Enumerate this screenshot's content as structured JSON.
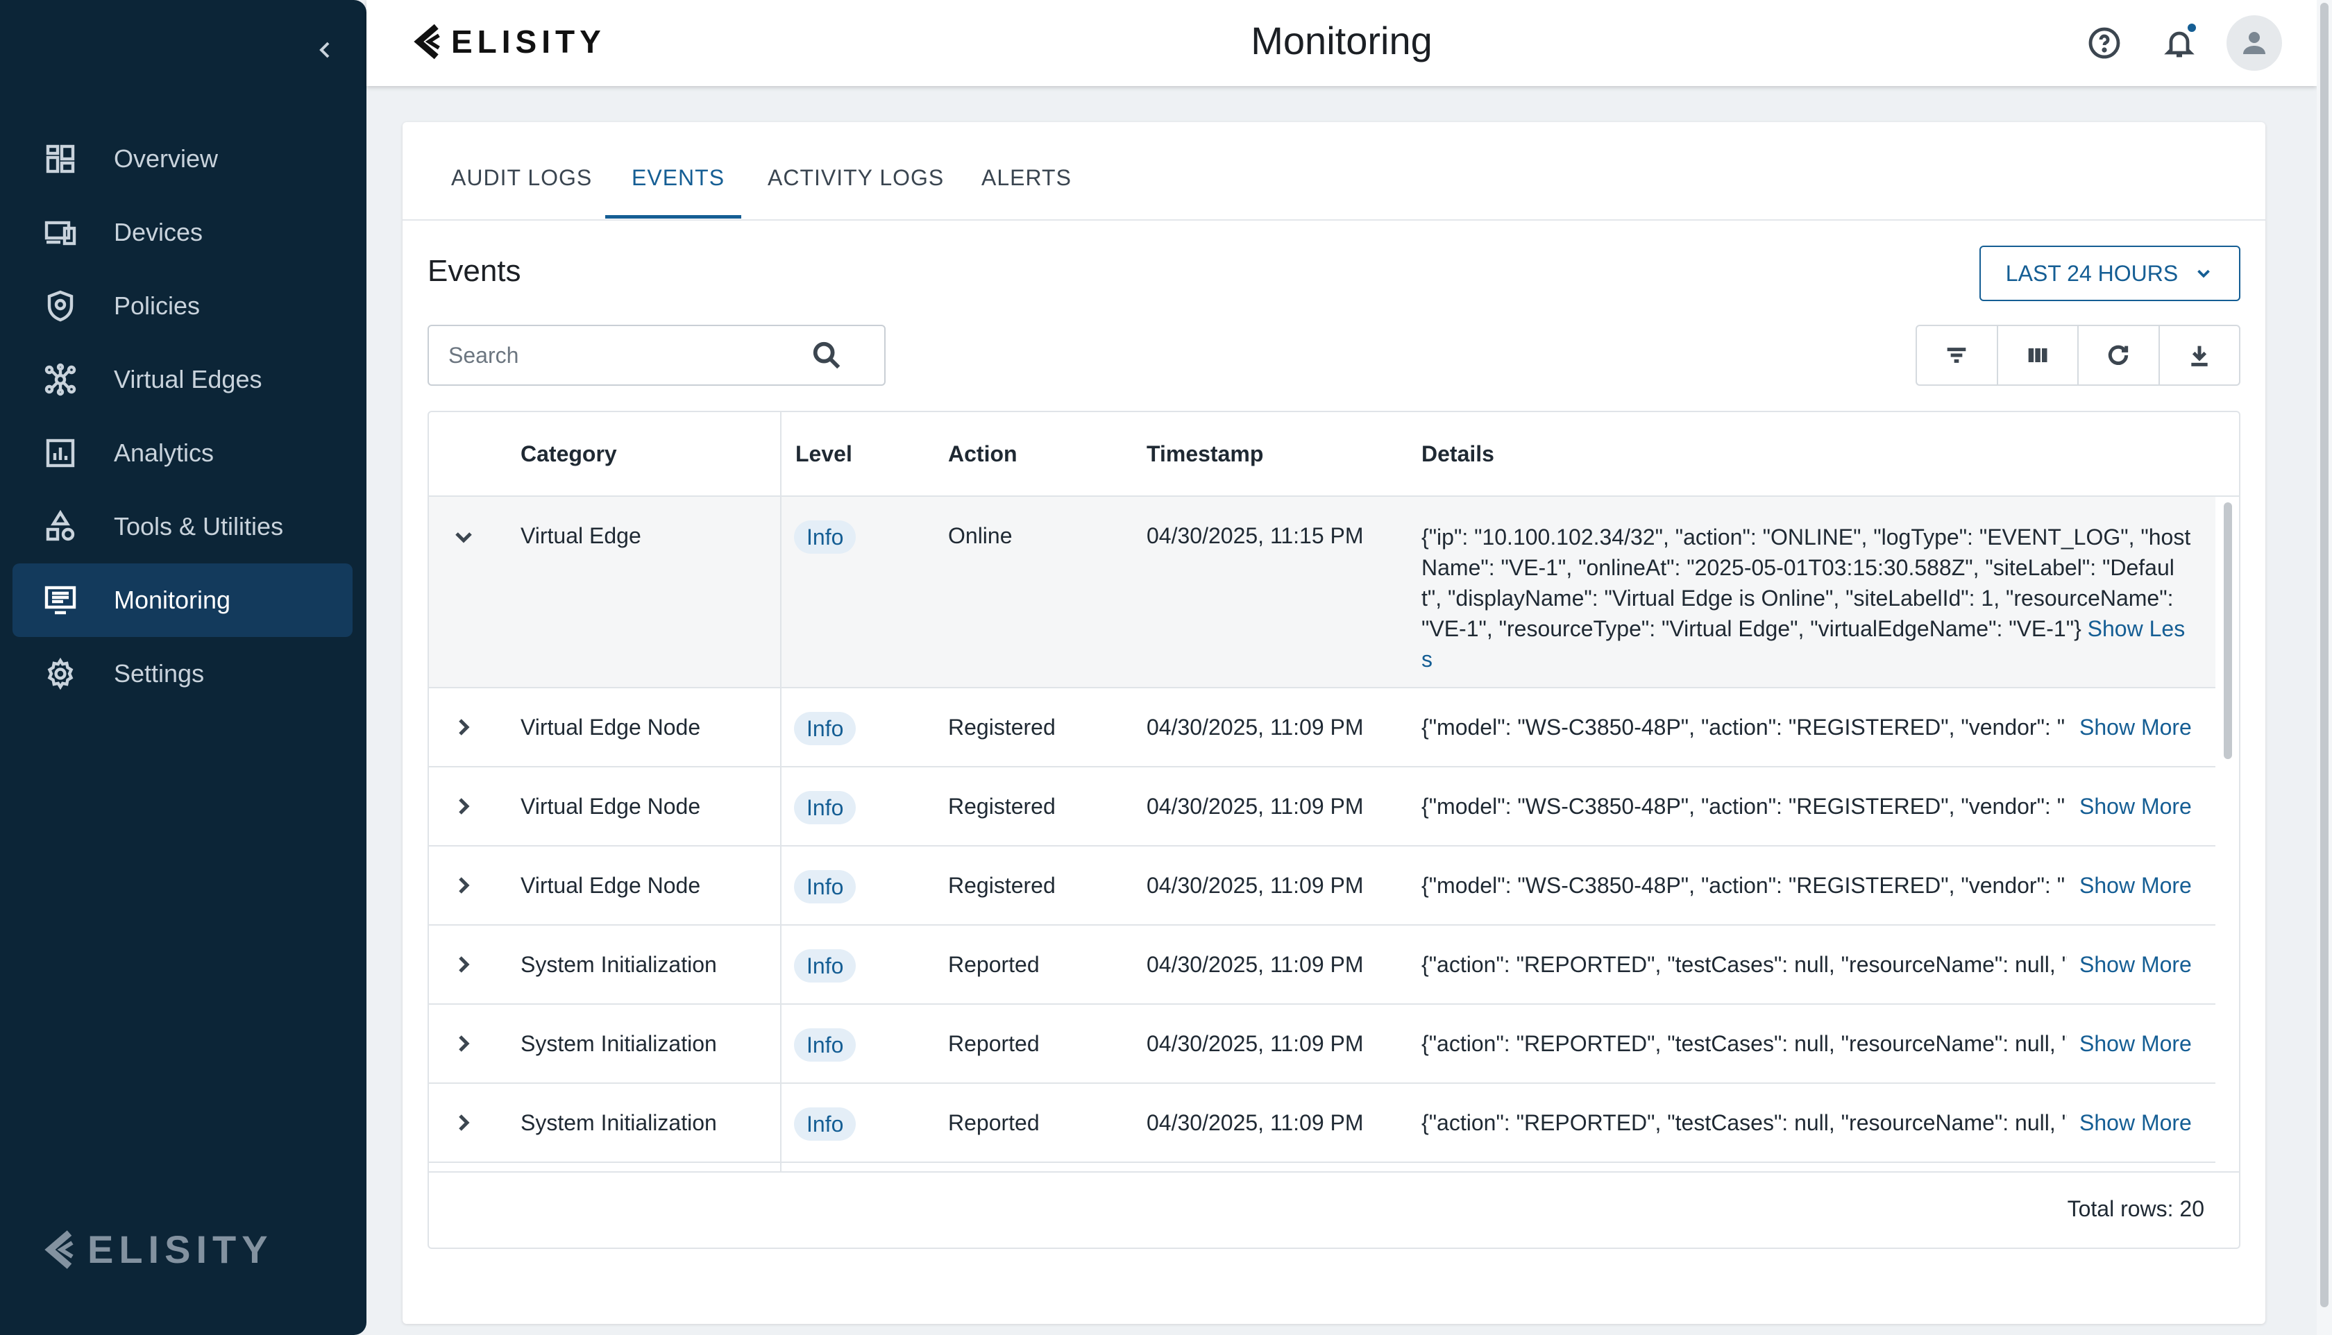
{
  "app": {
    "brand": "ELISITY",
    "page_title": "Monitoring"
  },
  "sidebar": {
    "items": [
      {
        "label": "Overview",
        "icon": "dashboard-icon",
        "active": false
      },
      {
        "label": "Devices",
        "icon": "devices-icon",
        "active": false
      },
      {
        "label": "Policies",
        "icon": "shield-icon",
        "active": false
      },
      {
        "label": "Virtual Edges",
        "icon": "network-icon",
        "active": false
      },
      {
        "label": "Analytics",
        "icon": "analytics-icon",
        "active": false
      },
      {
        "label": "Tools & Utilities",
        "icon": "tools-icon",
        "active": false
      },
      {
        "label": "Monitoring",
        "icon": "monitor-list-icon",
        "active": true
      },
      {
        "label": "Settings",
        "icon": "gear-icon",
        "active": false
      }
    ],
    "logo_text": "ELISITY"
  },
  "tabs": [
    {
      "label": "AUDIT LOGS"
    },
    {
      "label": "EVENTS"
    },
    {
      "label": "ACTIVITY LOGS"
    },
    {
      "label": "ALERTS"
    }
  ],
  "active_tab": "EVENTS",
  "events": {
    "title": "Events",
    "range_label": "LAST 24 HOURS",
    "search_placeholder": "Search",
    "columns": [
      "Category",
      "Level",
      "Action",
      "Timestamp",
      "Details"
    ],
    "rows": [
      {
        "category": "Virtual Edge",
        "level": "Info",
        "action": "Online",
        "timestamp": "04/30/2025, 11:15 PM",
        "details": "{\"ip\": \"10.100.102.34/32\", \"action\": \"ONLINE\", \"logType\": \"EVENT_LOG\", \"hostName\": \"VE-1\", \"onlineAt\": \"2025-05-01T03:15:30.588Z\", \"siteLabel\": \"Default\", \"displayName\": \"Virtual Edge is Online\", \"siteLabelId\": 1, \"resourceName\": \"VE-1\", \"resourceType\": \"Virtual Edge\", \"virtualEdgeName\": \"VE-1\"}",
        "toggle": "Show Less",
        "expanded": true
      },
      {
        "category": "Virtual Edge Node",
        "level": "Info",
        "action": "Registered",
        "timestamp": "04/30/2025, 11:09 PM",
        "details": "{\"model\": \"WS-C3850-48P\", \"action\": \"REGISTERED\", \"vendor\": \"",
        "toggle": "Show More",
        "expanded": false
      },
      {
        "category": "Virtual Edge Node",
        "level": "Info",
        "action": "Registered",
        "timestamp": "04/30/2025, 11:09 PM",
        "details": "{\"model\": \"WS-C3850-48P\", \"action\": \"REGISTERED\", \"vendor\": \"",
        "toggle": "Show More",
        "expanded": false
      },
      {
        "category": "Virtual Edge Node",
        "level": "Info",
        "action": "Registered",
        "timestamp": "04/30/2025, 11:09 PM",
        "details": "{\"model\": \"WS-C3850-48P\", \"action\": \"REGISTERED\", \"vendor\": \"",
        "toggle": "Show More",
        "expanded": false
      },
      {
        "category": "System Initialization",
        "level": "Info",
        "action": "Reported",
        "timestamp": "04/30/2025, 11:09 PM",
        "details": "{\"action\": \"REPORTED\", \"testCases\": null, \"resourceName\": null, \"",
        "toggle": "Show More",
        "expanded": false
      },
      {
        "category": "System Initialization",
        "level": "Info",
        "action": "Reported",
        "timestamp": "04/30/2025, 11:09 PM",
        "details": "{\"action\": \"REPORTED\", \"testCases\": null, \"resourceName\": null, \"",
        "toggle": "Show More",
        "expanded": false
      },
      {
        "category": "System Initialization",
        "level": "Info",
        "action": "Reported",
        "timestamp": "04/30/2025, 11:09 PM",
        "details": "{\"action\": \"REPORTED\", \"testCases\": null, \"resourceName\": null, \"",
        "toggle": "Show More",
        "expanded": false
      }
    ],
    "total_rows_label": "Total rows: 20"
  },
  "colors": {
    "sidebar_bg": "#0c2537",
    "sidebar_active": "#133a5c",
    "accent": "#155e94",
    "badge_bg": "#e4eef7"
  }
}
